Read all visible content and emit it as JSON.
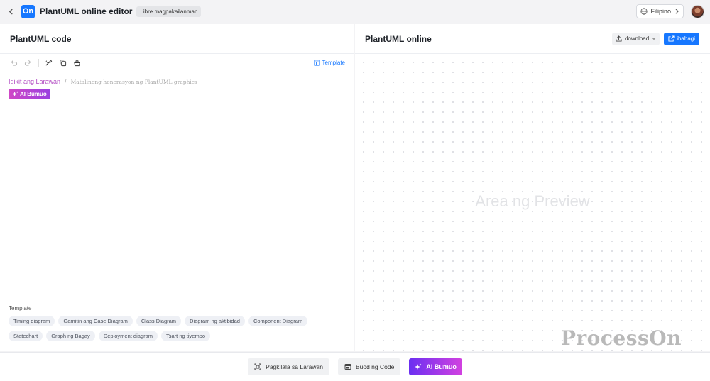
{
  "topbar": {
    "app_title": "PlantUML online editor",
    "free_badge": "Libre magpakailanman",
    "language": "Filipino"
  },
  "left_panel": {
    "title": "PlantUML code",
    "toolbar": {
      "tools": [
        "undo-icon",
        "redo-icon",
        "format-icon",
        "copy-icon",
        "clear-icon"
      ],
      "template_label": "Template"
    },
    "editor": {
      "hint_link": "Idikit ang Larawan",
      "hint_separator": "/",
      "hint_text": "Matalinong henerasyon ng PlantUML graphics",
      "ai_button": "AI Bumuo"
    },
    "templates": {
      "label": "Template",
      "items": [
        "Timing diagram",
        "Gamitin ang Case Diagram",
        "Class Diagram",
        "Diagram ng aktibidad",
        "Component Diagram",
        "Statechart",
        "Graph ng Bagay",
        "Deployment diagram",
        "Tsart ng tiyempo"
      ]
    }
  },
  "right_panel": {
    "title": "PlantUML online",
    "download_label": "download",
    "share_label": "ibahagi",
    "preview_placeholder": "Area ng Preview",
    "watermark": "ProcessOn"
  },
  "bottombar": {
    "recognize_image": "Pagkilala sa Larawan",
    "code_summary": "Buod ng Code",
    "ai_generate": "AI Bumuo"
  },
  "colors": {
    "accent": "#1677ff",
    "ai_gradient_start": "#6b2ff1",
    "ai_gradient_end": "#d241e0",
    "hint_link": "#b24bc3"
  }
}
